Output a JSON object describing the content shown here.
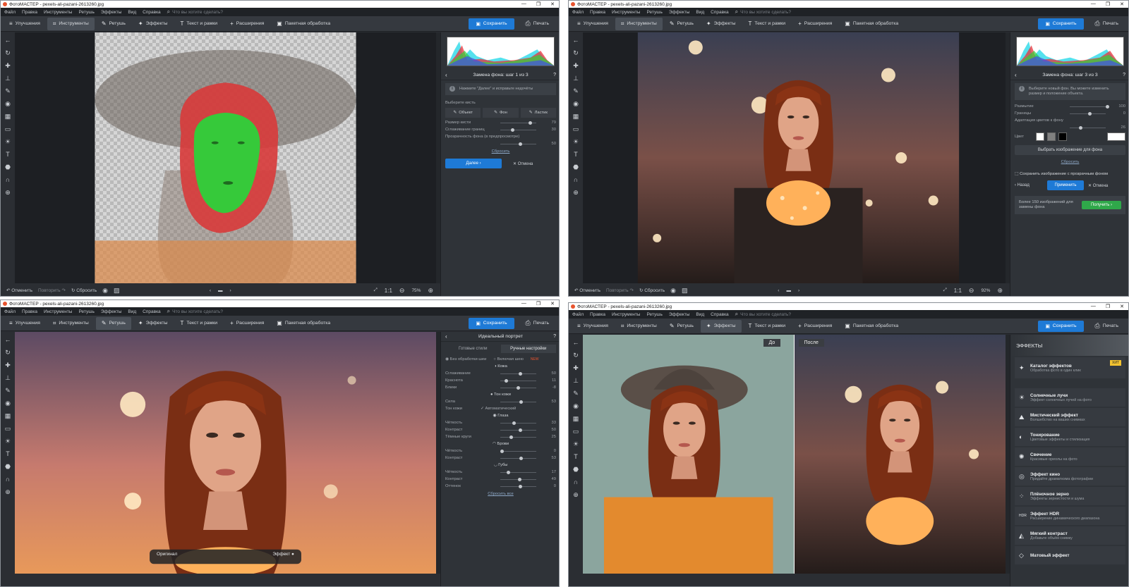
{
  "windows": [
    {
      "title": "ФотоМАСТЕР - pexels-ali-pazani-2613260.jpg",
      "active_tab": 1,
      "panel": "bg_step1",
      "bottom": {
        "undo": "Отменить",
        "redo": "Повторить",
        "reset": "Сбросить",
        "ratio": "1:1",
        "zoom": "75%"
      }
    },
    {
      "title": "ФотоМАСТЕР - pexels-ali-pazani-2613260.jpg",
      "active_tab": 1,
      "panel": "bg_step3",
      "bottom": {
        "undo": "Отменить",
        "redo": "Повторить",
        "reset": "Сбросить",
        "ratio": "1:1",
        "zoom": "92%"
      }
    },
    {
      "title": "ФотоМАСТЕР - pexels-ali-pazani-2613260.jpg",
      "active_tab": 2,
      "panel": "portrait"
    },
    {
      "title": "ФотоМАСТЕР - pexels-ali-pazani-2613260.jpg",
      "active_tab": 3,
      "panel": "effects",
      "before_label": "До",
      "after_label": "После"
    }
  ],
  "menu": [
    "Файл",
    "Правка",
    "Инструменты",
    "Ретушь",
    "Эффекты",
    "Вид",
    "Справка"
  ],
  "search_placeholder": "Что вы хотите сделать?",
  "tabs": [
    {
      "label": "Улучшения",
      "icon": "≡"
    },
    {
      "label": "Инструменты",
      "icon": "⌗"
    },
    {
      "label": "Ретушь",
      "icon": "✎"
    },
    {
      "label": "Эффекты",
      "icon": "✦"
    },
    {
      "label": "Текст и рамки",
      "icon": "T"
    },
    {
      "label": "Расширения",
      "icon": "+"
    },
    {
      "label": "Пакетная обработка",
      "icon": "▣"
    }
  ],
  "save_label": "Сохранить",
  "print_label": "Печать",
  "step1": {
    "title": "Замена фона: шаг 1 из 3",
    "hint": "Нажмите \"Далее\" и исправьте недочёты",
    "choose_brush": "Выберите кисть",
    "brushes": [
      "Объект",
      "Фон",
      "Ластик"
    ],
    "sliders": [
      {
        "label": "Размер кисти",
        "value": "79",
        "pos": 0.79
      },
      {
        "label": "Сглаживание границ",
        "value": "30",
        "pos": 0.3
      }
    ],
    "transparency_label": "Прозрачность фона (в предпросмотре)",
    "transparency_value": "50",
    "transparency_pos": 0.5,
    "reset": "Сбросить",
    "next": "Далее",
    "cancel": "Отмена"
  },
  "step3": {
    "title": "Замена фона: шаг 3 из 3",
    "hint": "Выберите новый фон. Вы можете изменить размер и положение объекта.",
    "sliders": [
      {
        "label": "Размытие",
        "value": "100",
        "pos": 1.0
      },
      {
        "label": "Границы",
        "value": "0",
        "pos": 0.5
      }
    ],
    "adapt_label": "Адаптация цветов к фону",
    "adapt_value": "26",
    "adapt_pos": 0.26,
    "color_label": "Цвет",
    "choose_bg": "Выбрать изображение для фона",
    "reset": "Сбросить",
    "save_transparent": "Сохранить изображение с прозрачным фоном",
    "back": "Назад",
    "apply": "Применить",
    "cancel": "Отмена",
    "promo": "Более 150 изображений для замены фона",
    "get": "Получить"
  },
  "portrait": {
    "title": "Идеальный портрет",
    "tabs": [
      "Готовые стили",
      "Ручные настройки"
    ],
    "opt1": "Без обработки шеи",
    "opt2": "Включая шею",
    "new": "NEW",
    "skin": "Кожа",
    "rows": [
      {
        "label": "Сглаживание",
        "value": "50",
        "pos": 0.5
      },
      {
        "label": "Краснота",
        "value": "11",
        "pos": 0.11
      },
      {
        "label": "Блики",
        "value": "-8",
        "pos": 0.46
      }
    ],
    "tone_head": "Тон кожи",
    "tone_rows": [
      {
        "label": "Сила",
        "value": "53",
        "pos": 0.53
      }
    ],
    "tone_label": "Тон кожи",
    "tone_auto": "Автоматический",
    "eyes": "Глаза",
    "eye_rows": [
      {
        "label": "Чёткость",
        "value": "33",
        "pos": 0.33
      },
      {
        "label": "Контраст",
        "value": "50",
        "pos": 0.5
      },
      {
        "label": "Тёмные круги",
        "value": "25",
        "pos": 0.25
      }
    ],
    "brows": "Брови",
    "brow_rows": [
      {
        "label": "Чёткость",
        "value": "0",
        "pos": 0.0
      },
      {
        "label": "Контраст",
        "value": "53",
        "pos": 0.53
      }
    ],
    "lips": "Губы",
    "lip_rows": [
      {
        "label": "Чёткость",
        "value": "17",
        "pos": 0.17
      },
      {
        "label": "Контраст",
        "value": "49",
        "pos": 0.49
      },
      {
        "label": "Оттенок",
        "value": "0",
        "pos": 0.5
      }
    ],
    "reset_all": "Сбросить все",
    "original": "Оригинал",
    "effect": "Эффект"
  },
  "effects": {
    "title": "ЭФФЕКТЫ",
    "items": [
      {
        "title": "Каталог эффектов",
        "desc": "Обработка фото в один клик",
        "icon": "✦",
        "badge": "ХИТ"
      },
      {
        "title": "Солнечные лучи",
        "desc": "Эффект солнечных лучей на фото",
        "icon": "☀"
      },
      {
        "title": "Мистический эффект",
        "desc": "Волшебство на ваших снимках",
        "icon": "⛰"
      },
      {
        "title": "Тонирование",
        "desc": "Цветовые эффекты и стилизация",
        "icon": "◐"
      },
      {
        "title": "Свечение",
        "desc": "Красивые ореолы на фото",
        "icon": "✺"
      },
      {
        "title": "Эффект кино",
        "desc": "Придайте драматизма фотографии",
        "icon": "◎"
      },
      {
        "title": "Плёночное зерно",
        "desc": "Эффекты зернистости и шума",
        "icon": "⁘"
      },
      {
        "title": "Эффект HDR",
        "desc": "Расширение динамического диапазона",
        "icon": "HDR"
      },
      {
        "title": "Мягкий контраст",
        "desc": "Добавьте объём снимку",
        "icon": "◭"
      },
      {
        "title": "Матовый эффект",
        "desc": "",
        "icon": "◇"
      }
    ]
  },
  "colors": {
    "accent": "#1e7ad6",
    "green": "#2fa84a",
    "mask_green": "#36c93a",
    "mask_red": "#d83a3a"
  }
}
